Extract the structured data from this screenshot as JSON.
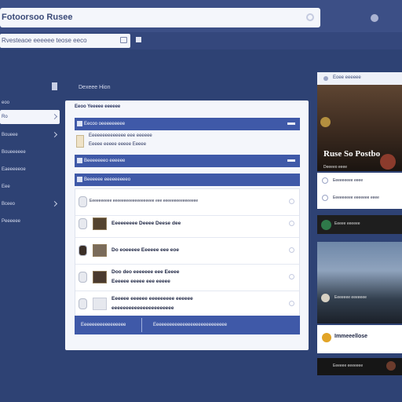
{
  "header": {
    "title": "Fotoorsoo Rusee",
    "search_placeholder": "Rvesteaoe eeeeee teose eeco"
  },
  "sidebar": {
    "section_label": "Dexeee Hion",
    "items": [
      {
        "label": "eoo"
      },
      {
        "label": "Ro",
        "active": true
      },
      {
        "label": "Boueee"
      },
      {
        "label": "Boueeeeee"
      },
      {
        "label": "Eaeeeeeoe"
      },
      {
        "label": "Eee"
      },
      {
        "label": "Bceeo"
      },
      {
        "label": "Peeeeee"
      }
    ]
  },
  "panel": {
    "heading": "Eeoo Yeeeee eeeeee",
    "bar1": "Eecoo oeeeeeeeee",
    "sub_line1": "Eeeeeeeeeeeeee eee eeeeee",
    "sub_line2": "Eeeee eeeee eeeee Eeeee",
    "bar2": "Beeeeeeeo eeeeee",
    "bar3": "Beeeeee eeeeeeeeeo",
    "list": [
      {
        "line1": "Eeeeeeeeee eeeeeeeeeeeeeeeeeee eee eeeeeeeeeeeeeeee",
        "line2": ""
      },
      {
        "line1": "Eeeeeeeee Deeee Deese dee",
        "line2": ""
      },
      {
        "line1": "Do eoeeeee Eeeeee eee eoe",
        "line2": ""
      },
      {
        "line1": "Doo deo eeeeeee eee Eeeee",
        "line2": "Eeeeee eeeee eee eeeee"
      },
      {
        "line1": "Eeeeee eeeeee eeeeeeeee eeeeee",
        "line2": "eeeeeeeeeeeeeeeeeeeeee"
      }
    ],
    "footer_buttons": [
      "Eeeeeeeeeeeeeeeee",
      "Eeeeeeeeeeeeeeeeeeeeeeeeeeee"
    ]
  },
  "feed": {
    "head_label": "Eoee eeeeee",
    "card1_headline": "Ruse So Postbo",
    "card1_caption": "Deeeeo eeee",
    "card2_lines": [
      "Eeeeeeeee eeee",
      "Eeeeeeeee eeeeeee eeee"
    ],
    "card3_line": "Eeeee eeeeee",
    "card4_caption": "Eeeeeee eeeeeee",
    "card5_name": "Immeeellose",
    "card6_line": "Eeeeee eeeeeee"
  }
}
